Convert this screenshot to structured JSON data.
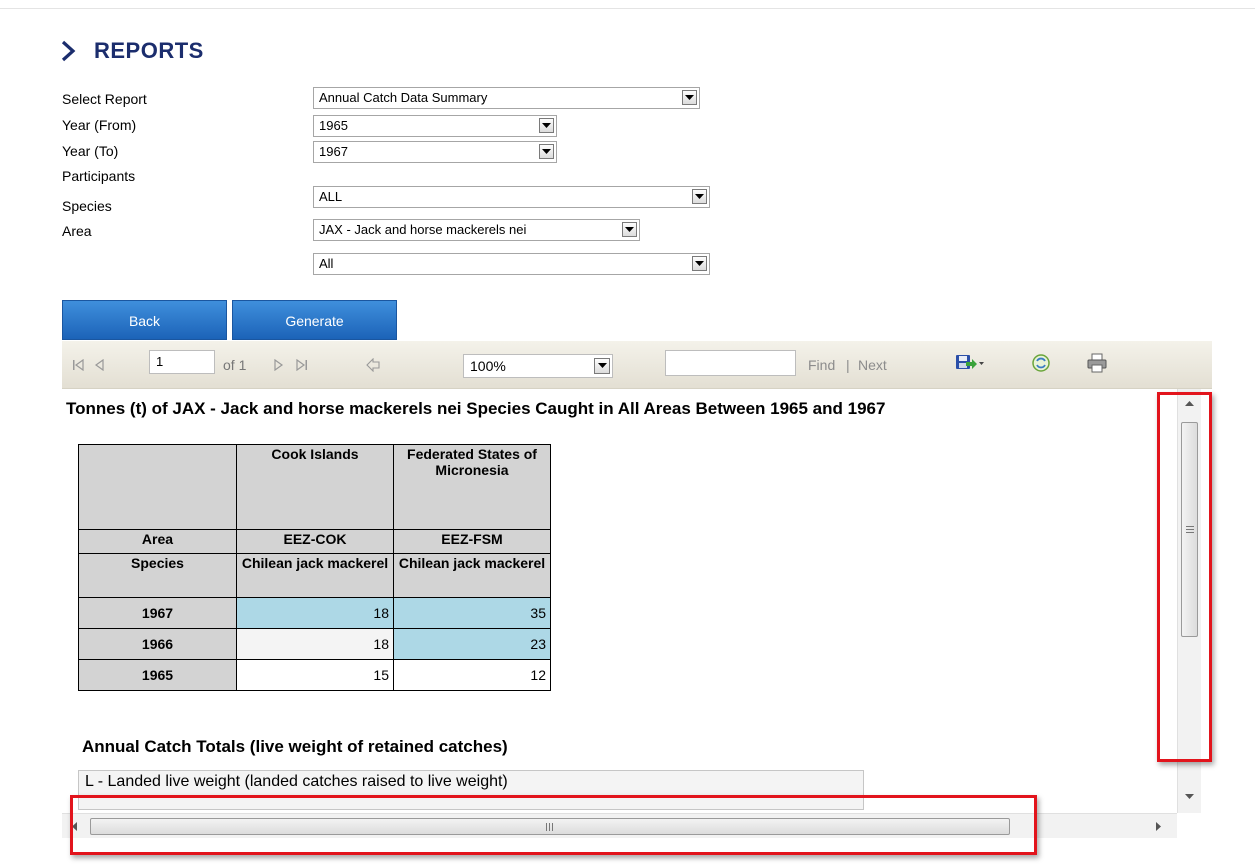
{
  "page": {
    "title": "REPORTS"
  },
  "form": {
    "select_report": {
      "label": "Select Report",
      "value": "Annual Catch Data Summary"
    },
    "year_from": {
      "label": "Year (From)",
      "value": "1965"
    },
    "year_to": {
      "label": "Year (To)",
      "value": "1967"
    },
    "participants": {
      "label": "Participants",
      "value": "ALL"
    },
    "species": {
      "label": "Species",
      "value": "JAX - Jack and horse mackerels nei"
    },
    "area": {
      "label": "Area",
      "value": "All"
    }
  },
  "buttons": {
    "back": "Back",
    "generate": "Generate"
  },
  "toolbar": {
    "page_number": "1",
    "page_of": "of 1",
    "zoom": "100%",
    "find_value": "",
    "find_label": "Find",
    "separator": "|",
    "next_label": "Next"
  },
  "report": {
    "title": "Tonnes (t) of JAX - Jack and horse mackerels nei Species  Caught in All Areas Between 1965 and 1967",
    "table": {
      "participants": [
        "Cook Islands",
        "Federated States of Micronesia"
      ],
      "area_label": "Area",
      "areas": [
        "EEZ-COK",
        "EEZ-FSM"
      ],
      "species_label": "Species",
      "species": [
        "Chilean jack mackerel",
        "Chilean jack mackerel"
      ],
      "rows": [
        {
          "year": "1967",
          "values": [
            "18",
            "35"
          ]
        },
        {
          "year": "1966",
          "values": [
            "18",
            "23"
          ]
        },
        {
          "year": "1965",
          "values": [
            "15",
            "12"
          ]
        }
      ],
      "highlight_color": "#add8e6"
    },
    "totals_title": "Annual Catch Totals (live weight of retained catches)",
    "legend_text": "L - Landed live weight (landed catches raised to live weight)"
  },
  "colors": {
    "title": "#1b2d6d",
    "button": "#2a73c8",
    "annotation": "#e2141c"
  },
  "icons": {
    "heading": "chevron-right-icon",
    "first": "first-page-icon",
    "prev": "previous-page-icon",
    "next": "next-page-icon",
    "last": "last-page-icon",
    "back": "back-icon",
    "export": "export-save-icon",
    "refresh": "refresh-icon",
    "print": "print-icon"
  }
}
